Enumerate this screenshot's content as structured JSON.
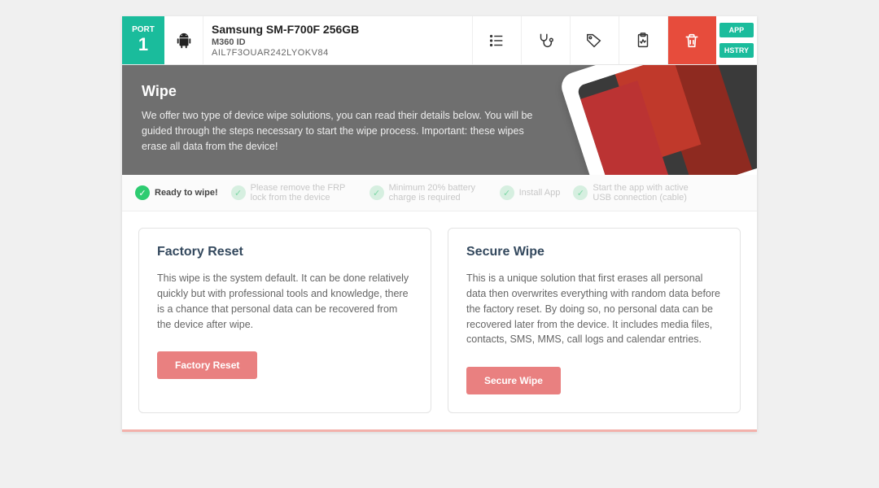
{
  "port": {
    "label": "PORT",
    "number": "1"
  },
  "device": {
    "title": "Samsung SM-F700F 256GB",
    "id_label": "M360 ID",
    "id_value": "AIL7F3OUAR242LYOKV84"
  },
  "side_buttons": {
    "app": "APP",
    "history": "HSTRY"
  },
  "hero": {
    "title": "Wipe",
    "body": "We offer two type of device wipe solutions, you can read their details below. You will be guided through the steps necessary to start the wipe process. Important: these wipes erase all data from the device!"
  },
  "steps": [
    {
      "text": "Ready to wipe!",
      "active": true
    },
    {
      "text": "Please remove the FRP lock from the device",
      "active": false
    },
    {
      "text": "Minimum 20% battery charge is required",
      "active": false
    },
    {
      "text": "Install App",
      "active": false
    },
    {
      "text": "Start the app with active USB connection (cable)",
      "active": false
    }
  ],
  "cards": {
    "factory": {
      "title": "Factory Reset",
      "body": "This wipe is the system default. It can be done relatively quickly but with professional tools and knowledge, there is a chance that personal data can be recovered from the device after wipe.",
      "button": "Factory Reset"
    },
    "secure": {
      "title": "Secure Wipe",
      "body": "This is a unique solution that first erases all personal data then overwrites everything with random data before the factory reset. By doing so, no personal data can be recovered later from the device. It includes media files, contacts, SMS, MMS, call logs and calendar entries.",
      "button": "Secure Wipe"
    }
  }
}
